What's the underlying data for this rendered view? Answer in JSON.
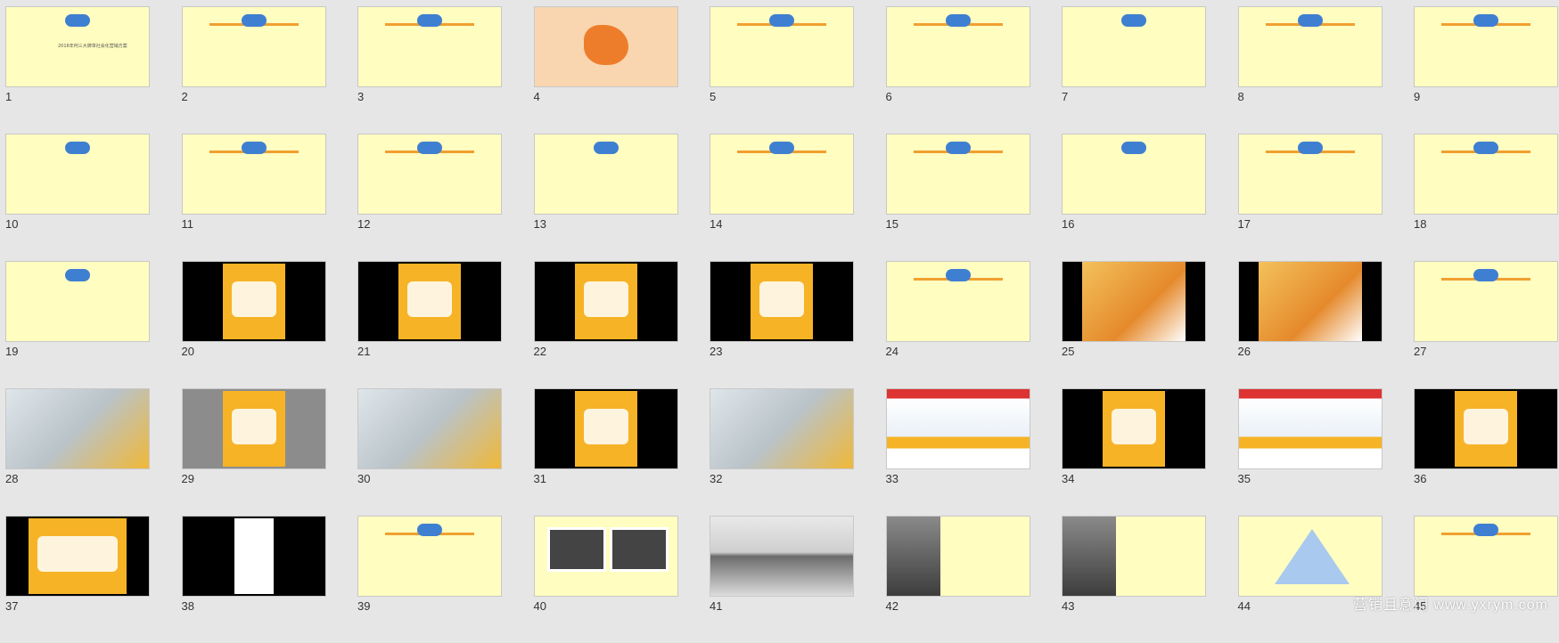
{
  "app": {
    "view": "slide-sorter",
    "watermark": "营销且意门 www.yxrym.com"
  },
  "slides": [
    {
      "n": "1",
      "style": "cream",
      "caption": "2016年何三大牌单社会化营销方案"
    },
    {
      "n": "2",
      "style": "cream",
      "caption": ""
    },
    {
      "n": "3",
      "style": "cream",
      "caption": ""
    },
    {
      "n": "4",
      "style": "orange",
      "caption": ""
    },
    {
      "n": "5",
      "style": "cream",
      "caption": ""
    },
    {
      "n": "6",
      "style": "cream",
      "caption": ""
    },
    {
      "n": "7",
      "style": "cream",
      "caption": ""
    },
    {
      "n": "8",
      "style": "cream",
      "caption": ""
    },
    {
      "n": "9",
      "style": "cream",
      "caption": ""
    },
    {
      "n": "10",
      "style": "cream",
      "caption": ""
    },
    {
      "n": "11",
      "style": "cream",
      "caption": ""
    },
    {
      "n": "12",
      "style": "cream",
      "caption": ""
    },
    {
      "n": "13",
      "style": "cream",
      "caption": ""
    },
    {
      "n": "14",
      "style": "cream",
      "caption": ""
    },
    {
      "n": "15",
      "style": "cream",
      "caption": ""
    },
    {
      "n": "16",
      "style": "cream",
      "caption": ""
    },
    {
      "n": "17",
      "style": "cream",
      "caption": ""
    },
    {
      "n": "18",
      "style": "cream",
      "caption": ""
    },
    {
      "n": "19",
      "style": "cream",
      "caption": ""
    },
    {
      "n": "20",
      "style": "dark-poster",
      "caption": ""
    },
    {
      "n": "21",
      "style": "dark-poster",
      "caption": ""
    },
    {
      "n": "22",
      "style": "dark-poster",
      "caption": ""
    },
    {
      "n": "23",
      "style": "dark-poster",
      "caption": ""
    },
    {
      "n": "24",
      "style": "cream",
      "caption": ""
    },
    {
      "n": "25",
      "style": "dark-photo",
      "caption": ""
    },
    {
      "n": "26",
      "style": "dark-photo",
      "caption": ""
    },
    {
      "n": "27",
      "style": "cream",
      "caption": ""
    },
    {
      "n": "28",
      "style": "photo",
      "caption": ""
    },
    {
      "n": "29",
      "style": "gray-poster",
      "caption": ""
    },
    {
      "n": "30",
      "style": "photo",
      "caption": ""
    },
    {
      "n": "31",
      "style": "dark-poster",
      "caption": ""
    },
    {
      "n": "32",
      "style": "photo",
      "caption": ""
    },
    {
      "n": "33",
      "style": "web",
      "caption": ""
    },
    {
      "n": "34",
      "style": "dark-poster",
      "caption": ""
    },
    {
      "n": "35",
      "style": "web",
      "caption": ""
    },
    {
      "n": "36",
      "style": "dark-poster",
      "caption": ""
    },
    {
      "n": "37",
      "style": "dark-screen",
      "caption": ""
    },
    {
      "n": "38",
      "style": "dark-phone",
      "caption": ""
    },
    {
      "n": "39",
      "style": "cream",
      "caption": ""
    },
    {
      "n": "40",
      "style": "cream-photos",
      "caption": ""
    },
    {
      "n": "41",
      "style": "photo-hands",
      "caption": ""
    },
    {
      "n": "42",
      "style": "photo-text",
      "caption": ""
    },
    {
      "n": "43",
      "style": "photo-text",
      "caption": ""
    },
    {
      "n": "44",
      "style": "cream-pyramid",
      "caption": ""
    },
    {
      "n": "45",
      "style": "cream",
      "caption": ""
    }
  ],
  "colors": {
    "cream": "#fffdc0",
    "accent": "#f0a030",
    "blue": "#3f7fd1",
    "dark": "#000000"
  }
}
